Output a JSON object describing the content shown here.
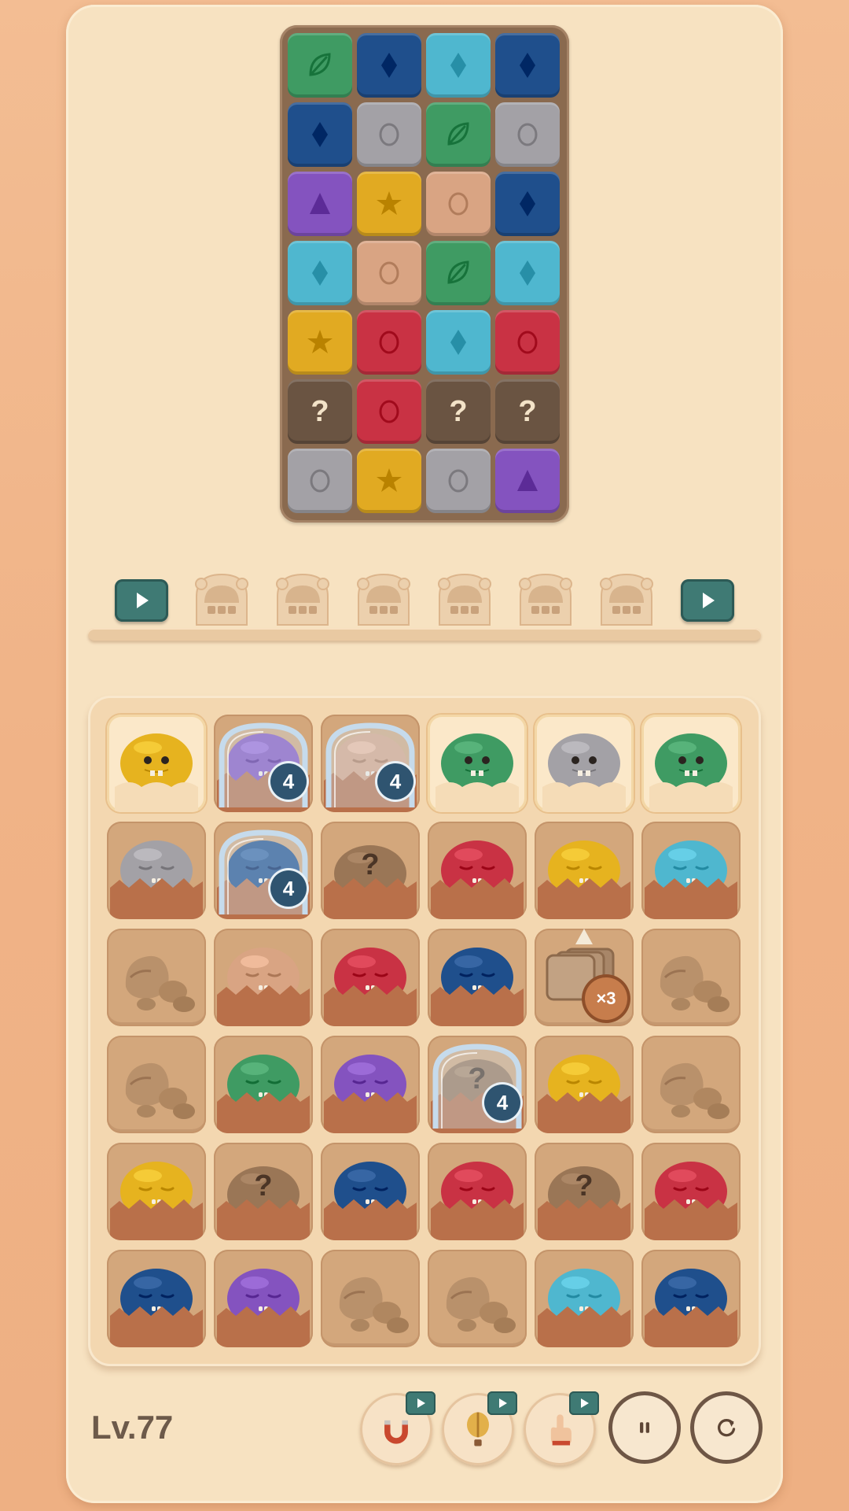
{
  "level": {
    "label": "Lv.77"
  },
  "colors": {
    "green": "#3f9b63",
    "navy": "#1f4f8c",
    "cyan": "#4fb7cf",
    "gray": "#a3a1a6",
    "purple": "#8453bf",
    "yellow": "#e1aa22",
    "peach": "#d9a483",
    "red": "#c93244",
    "hidden": "#6a5442",
    "yellowMonster": "#e6b31f",
    "teal": "#3f7a74"
  },
  "top_grid": [
    [
      "green-leaf",
      "navy-diamond",
      "cyan-diamond",
      "navy-diamond"
    ],
    [
      "navy-diamond",
      "gray-circle",
      "green-leaf",
      "gray-circle"
    ],
    [
      "purple-triangle",
      "yellow-star",
      "peach-circle",
      "navy-diamond"
    ],
    [
      "cyan-diamond",
      "peach-circle",
      "green-leaf",
      "cyan-diamond"
    ],
    [
      "yellow-star",
      "red-circle",
      "cyan-diamond",
      "red-circle"
    ],
    [
      "hidden",
      "red-circle",
      "hidden",
      "hidden"
    ],
    [
      "gray-circle",
      "yellow-star",
      "gray-circle",
      "purple-triangle"
    ]
  ],
  "hidden_label": "?",
  "conveyor": {
    "slots": 6,
    "left_button": "play-icon",
    "right_button": "play-icon"
  },
  "board": [
    [
      {
        "t": "monster",
        "c": "yellowMonster",
        "awake": true,
        "open": true
      },
      {
        "t": "frozen",
        "c": "purple",
        "n": "4"
      },
      {
        "t": "frozen",
        "c": "peach",
        "n": "4"
      },
      {
        "t": "monster",
        "c": "green",
        "awake": true,
        "open": true
      },
      {
        "t": "monster",
        "c": "gray",
        "awake": true,
        "open": true
      },
      {
        "t": "monster",
        "c": "green",
        "awake": true,
        "open": true
      }
    ],
    [
      {
        "t": "monster",
        "c": "gray"
      },
      {
        "t": "frozen",
        "c": "navy",
        "n": "4"
      },
      {
        "t": "mystery",
        "label": "?"
      },
      {
        "t": "monster",
        "c": "red"
      },
      {
        "t": "monster",
        "c": "yellowMonster"
      },
      {
        "t": "monster",
        "c": "cyan"
      }
    ],
    [
      {
        "t": "rock"
      },
      {
        "t": "monster",
        "c": "peach"
      },
      {
        "t": "monster",
        "c": "red"
      },
      {
        "t": "monster",
        "c": "navy"
      },
      {
        "t": "stack",
        "label": "×3"
      },
      {
        "t": "rock"
      }
    ],
    [
      {
        "t": "rock"
      },
      {
        "t": "monster",
        "c": "green"
      },
      {
        "t": "monster",
        "c": "purple"
      },
      {
        "t": "frozen-mystery",
        "n": "4",
        "label": "?"
      },
      {
        "t": "monster",
        "c": "yellowMonster"
      },
      {
        "t": "rock"
      }
    ],
    [
      {
        "t": "monster",
        "c": "yellowMonster"
      },
      {
        "t": "mystery",
        "label": "?"
      },
      {
        "t": "monster",
        "c": "navy"
      },
      {
        "t": "monster",
        "c": "red"
      },
      {
        "t": "mystery",
        "label": "?"
      },
      {
        "t": "monster",
        "c": "red"
      }
    ],
    [
      {
        "t": "monster",
        "c": "navy"
      },
      {
        "t": "monster",
        "c": "purple"
      },
      {
        "t": "rock"
      },
      {
        "t": "rock"
      },
      {
        "t": "monster",
        "c": "cyan"
      },
      {
        "t": "monster",
        "c": "navy"
      }
    ]
  ],
  "toolbar": {
    "boosters": [
      {
        "name": "magnet-icon"
      },
      {
        "name": "balloon-icon"
      },
      {
        "name": "finger-icon"
      }
    ],
    "pause": "pause-icon",
    "restart": "restart-icon"
  }
}
